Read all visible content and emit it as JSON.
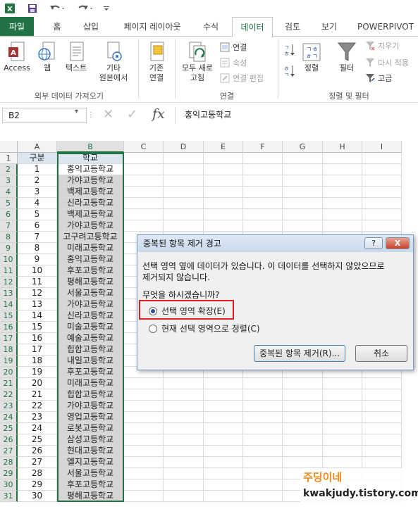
{
  "qat": {
    "app_icon": "excel-icon",
    "items": [
      "save-icon",
      "undo-icon",
      "redo-icon",
      "customize-icon"
    ]
  },
  "tabs": [
    {
      "label": "파일"
    },
    {
      "label": "홈"
    },
    {
      "label": "삽입"
    },
    {
      "label": "페이지 레이아웃"
    },
    {
      "label": "수식"
    },
    {
      "label": "데이터",
      "active": true
    },
    {
      "label": "검토"
    },
    {
      "label": "보기"
    },
    {
      "label": "POWERPIVOT"
    }
  ],
  "ribbon": {
    "external": {
      "access": "Access",
      "web": "웹",
      "text": "텍스트",
      "other1": "기타",
      "other2": "원본에서",
      "group": "외부 데이터 가져오기"
    },
    "existing": {
      "line1": "기존",
      "line2": "연결"
    },
    "connections": {
      "refresh1": "모두 새로",
      "refresh2": "고침",
      "connect": "연결",
      "props": "속성",
      "edit_links": "연결 편집",
      "group": "연결"
    },
    "sort": {
      "sort": "정렬",
      "filter": "필터",
      "clear": "지우기",
      "reapply": "다시 적용",
      "advanced": "고급",
      "group": "정렬 및 필터"
    }
  },
  "formula_bar": {
    "name_box": "B2",
    "fx": "fx",
    "value": "홍익고등학교"
  },
  "grid": {
    "columns": [
      "A",
      "B",
      "C",
      "D",
      "E",
      "F",
      "G",
      "H",
      "I"
    ],
    "header_row": {
      "a": "구분",
      "b": "학교"
    },
    "rows": [
      {
        "a": "1",
        "b": "홍익고등학교"
      },
      {
        "a": "2",
        "b": "가야고등학교"
      },
      {
        "a": "3",
        "b": "백제고등학교"
      },
      {
        "a": "4",
        "b": "신라고등학교"
      },
      {
        "a": "5",
        "b": "백제고등학교"
      },
      {
        "a": "6",
        "b": "가야고등학교"
      },
      {
        "a": "7",
        "b": "고구려고등학교"
      },
      {
        "a": "8",
        "b": "미래고등학교"
      },
      {
        "a": "9",
        "b": "홍익고등학교"
      },
      {
        "a": "10",
        "b": "후포고등학교"
      },
      {
        "a": "11",
        "b": "평해고등학교"
      },
      {
        "a": "12",
        "b": "서울고등학교"
      },
      {
        "a": "13",
        "b": "가야고등학교"
      },
      {
        "a": "14",
        "b": "신라고등학교"
      },
      {
        "a": "15",
        "b": "미술고등학교"
      },
      {
        "a": "16",
        "b": "예술고등학교"
      },
      {
        "a": "17",
        "b": "힙합고등학교"
      },
      {
        "a": "18",
        "b": "내일고등학교"
      },
      {
        "a": "19",
        "b": "후포고등학교"
      },
      {
        "a": "20",
        "b": "미래고등학교"
      },
      {
        "a": "21",
        "b": "힙합고등학교"
      },
      {
        "a": "22",
        "b": "가야고등학교"
      },
      {
        "a": "23",
        "b": "영업고등학교"
      },
      {
        "a": "24",
        "b": "로봇고등학교"
      },
      {
        "a": "25",
        "b": "삼성고등학교"
      },
      {
        "a": "26",
        "b": "현대고등학교"
      },
      {
        "a": "27",
        "b": "엘지고등학교"
      },
      {
        "a": "28",
        "b": "서울고등학교"
      },
      {
        "a": "29",
        "b": "후포고등학교"
      },
      {
        "a": "30",
        "b": "평해고등학교"
      }
    ]
  },
  "dialog": {
    "title": "중복된 항목 제거 경고",
    "help": "?",
    "close": "X",
    "message1": "선택 영역 옆에 데이터가 있습니다. 이 데이터를 선택하지 않았으므로",
    "message2": "제거되지 않습니다.",
    "question": "무엇을 하시겠습니까?",
    "option_expand": "선택 영역 확장(E)",
    "option_current": "현재 선택 영역으로 정렬(C)",
    "remove_button": "중복된 항목 제거(R)...",
    "cancel_button": "취소"
  },
  "watermark": {
    "title": "주딩이네",
    "url": "kwakjudy.tistory.com"
  },
  "colors": {
    "accent": "#217346",
    "highlight": "#e02020",
    "header_fill": "#dce6f1",
    "selection_fill": "#d6d6d6"
  }
}
